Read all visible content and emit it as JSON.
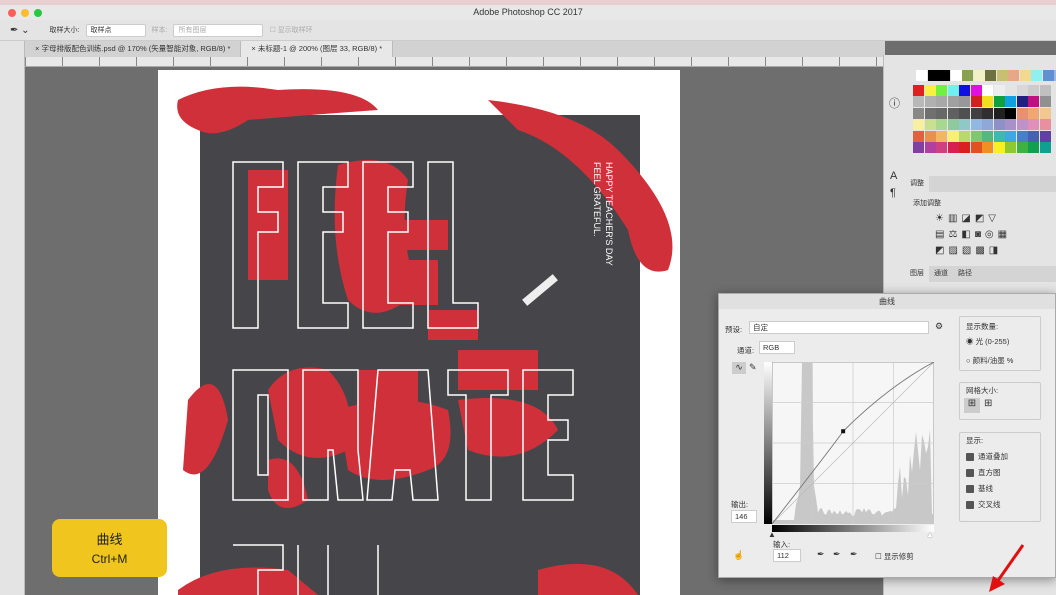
{
  "app": {
    "title": "Adobe Photoshop CC 2017"
  },
  "options": {
    "sample_size_label": "取样大小:",
    "sample_size_value": "取样点",
    "sample_label": "样本:",
    "sample_value": "所有图层",
    "show_ring_label": "显示取样环"
  },
  "tabs": [
    {
      "label": "字母排版配色训练.psd @ 170% (矢量智能对象, RGB/8) *"
    },
    {
      "label": "未标题-1 @ 200% (图层 33, RGB/8) *"
    }
  ],
  "poster": {
    "side_line1": "HAPPY TEACHER'S DAY",
    "side_line2": "FEEL GRATEFUL.",
    "words": [
      "FEEL",
      "GRATE",
      "FUL"
    ]
  },
  "panels": {
    "adjust_tab": "调整",
    "add_adjust": "添加调整",
    "layer_tabs": [
      "图层",
      "通道",
      "路径"
    ]
  },
  "swatches": [
    "#fff",
    "#000",
    "#000",
    "#fff",
    "#88a050",
    "#f3f0c8",
    "#6e7040",
    "#c8c070",
    "#e8a888",
    "#f2d890",
    "#90f0f0",
    "#6090d0",
    "#a0b8e0",
    "#e02020",
    "#f8f040",
    "#70f040",
    "#70f0f0",
    "#1010e0",
    "#e010e0",
    "#fff",
    "#eee",
    "#e4e4e4",
    "#d8d8d8",
    "#ccc",
    "#c0c0c0",
    "#b8b8b8",
    "#b0b0b0",
    "#a8a8a8",
    "#a0a0a0",
    "#989898",
    "#d02020",
    "#f0e020",
    "#10a040",
    "#10a0e0",
    "#202080",
    "#c01080",
    "#909090",
    "#888",
    "#707070",
    "#686868",
    "#606060",
    "#505050",
    "#404040",
    "#303030",
    "#202020",
    "#000",
    "#e89070",
    "#f0a870",
    "#f0c890",
    "#f8f0a0",
    "#c8e090",
    "#a8d890",
    "#90c8a0",
    "#90c8c8",
    "#90b8e0",
    "#90a8d8",
    "#9090c8",
    "#a890c8",
    "#c090c8",
    "#e090b8",
    "#e890a0",
    "#e06040",
    "#e89050",
    "#f0b860",
    "#f8f070",
    "#b8d870",
    "#80c870",
    "#50b880",
    "#40b8b0",
    "#40a8e0",
    "#4880c8",
    "#4860b0",
    "#6040a0",
    "#8040a0",
    "#b040a0",
    "#d04080",
    "#d82050",
    "#d82020",
    "#e05020",
    "#f09020",
    "#f8f020",
    "#90c830",
    "#40b040",
    "#10a050",
    "#10a090"
  ],
  "curves": {
    "title": "曲线",
    "preset_label": "预设:",
    "preset_value": "自定",
    "channel_label": "通道:",
    "channel_value": "RGB",
    "output_label": "输出:",
    "output_value": "146",
    "input_label": "输入:",
    "input_value": "112",
    "show_clipping": "显示修剪",
    "show_amount_label": "显示数量:",
    "light_option": "光 (0-255)",
    "pigment_option": "颜料/油墨 %",
    "grid_size_label": "网格大小:",
    "show_label": "显示:",
    "show_options": [
      "通道叠加",
      "直方图",
      "基线",
      "交叉线"
    ]
  },
  "badge": {
    "title": "曲线",
    "shortcut": "Ctrl+M"
  },
  "colors": {
    "red": "#d0303a",
    "poster_bg": "#46464a",
    "badge": "#f0c61e"
  }
}
